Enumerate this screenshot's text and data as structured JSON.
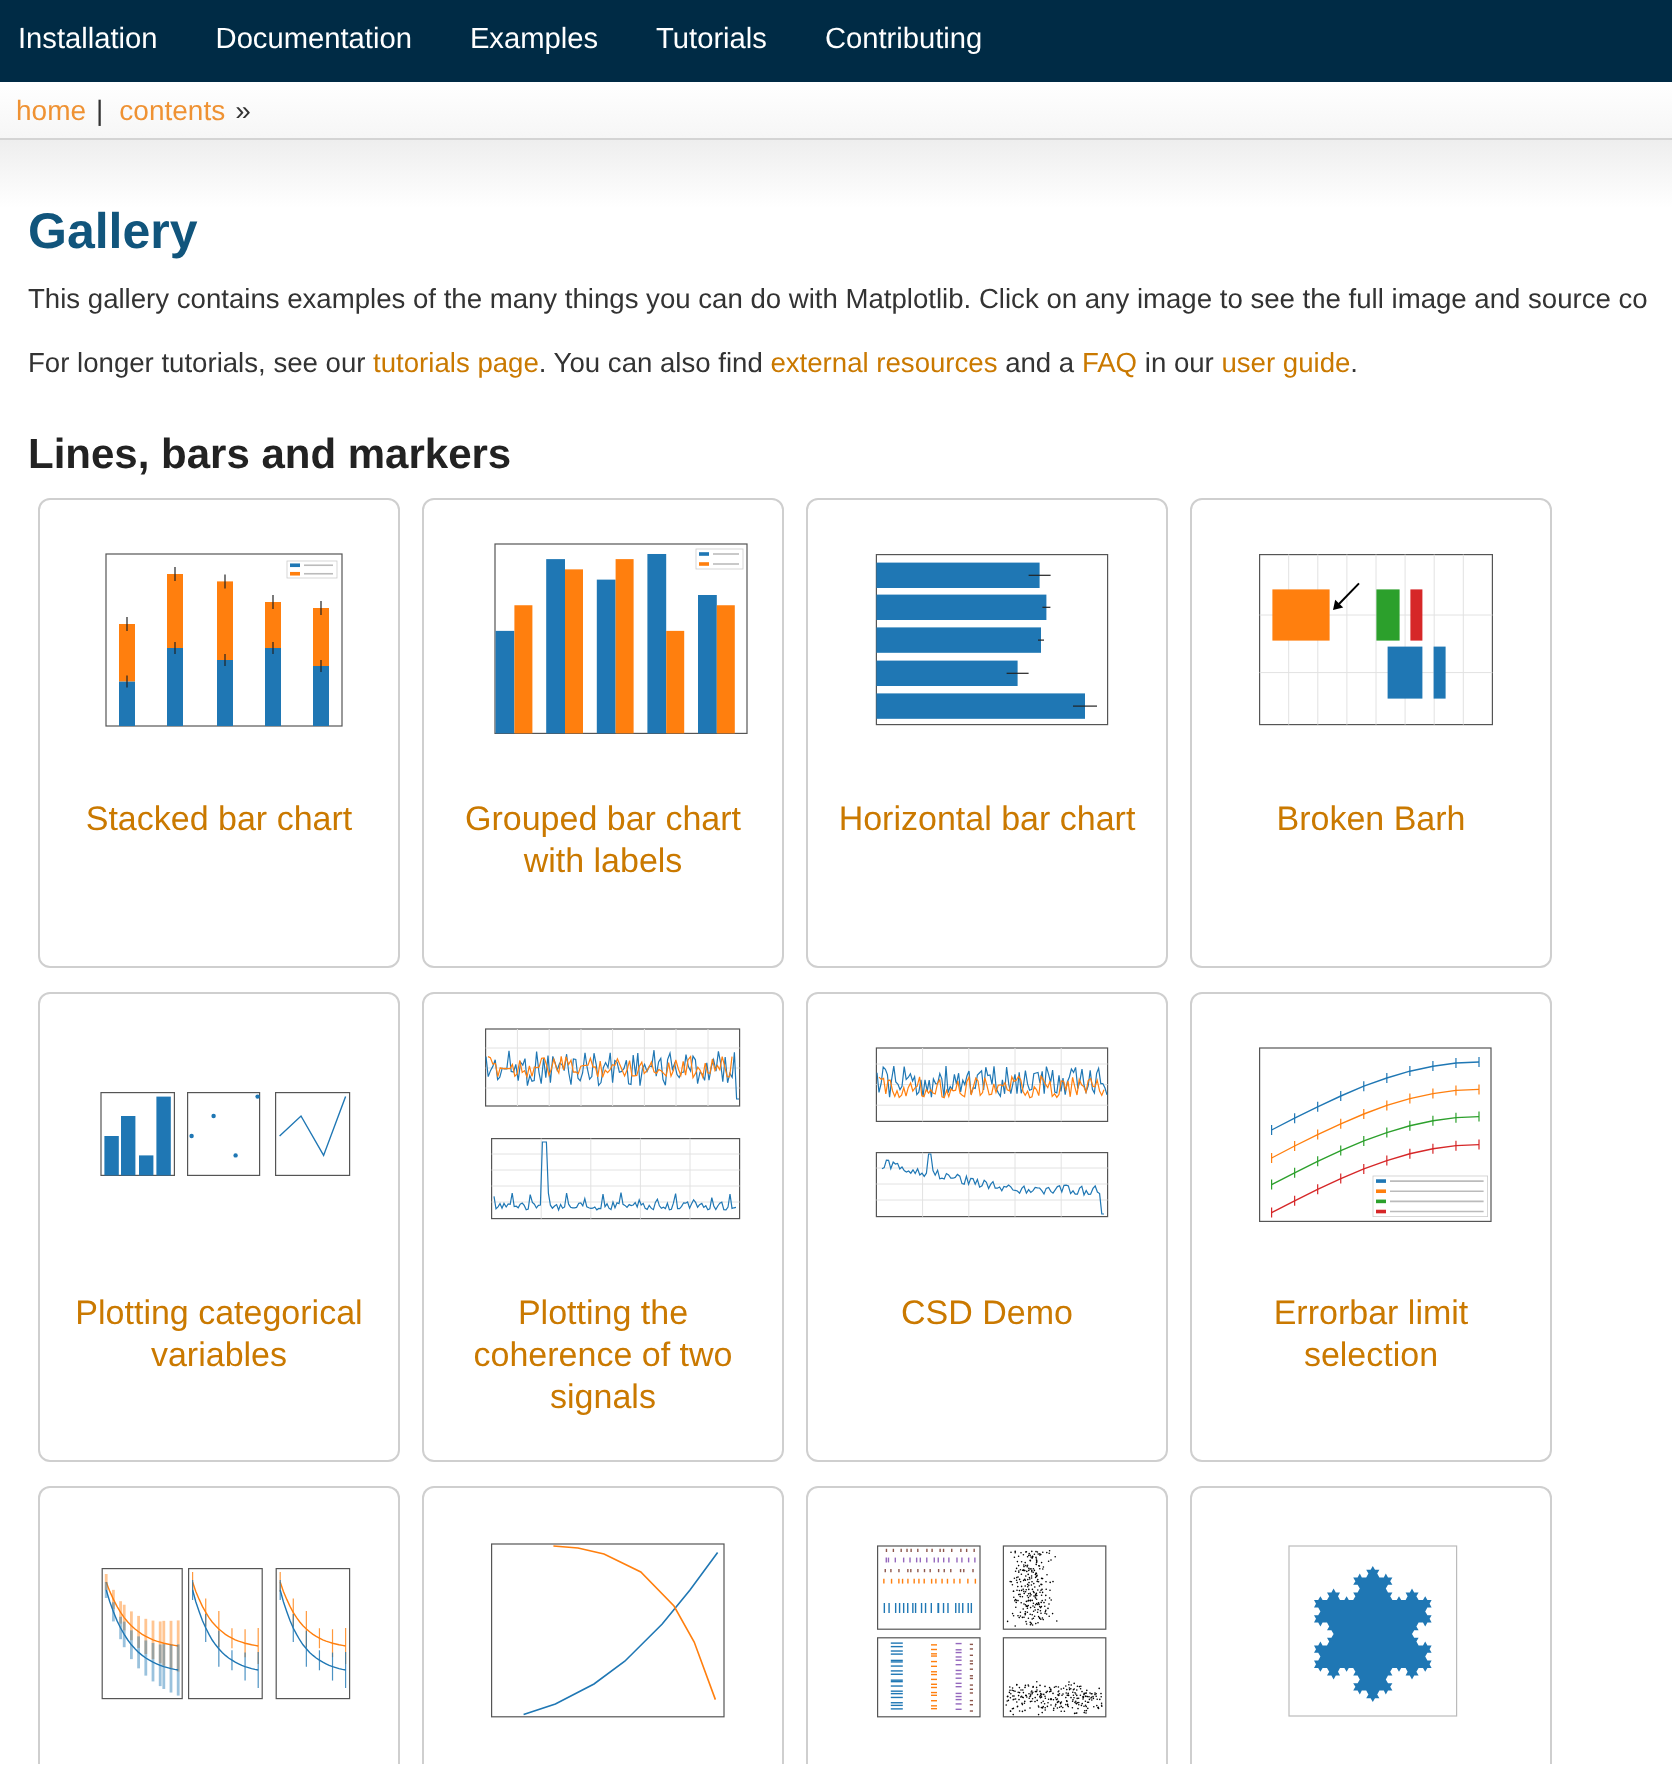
{
  "nav_items": [
    "Installation",
    "Documentation",
    "Examples",
    "Tutorials",
    "Contributing"
  ],
  "breadcrumb": [
    {
      "label": "home",
      "separator": "|"
    },
    {
      "label": "contents",
      "separator": "»"
    }
  ],
  "page": {
    "title": "Gallery",
    "intro": "This gallery contains examples of the many things you can do with Matplotlib. Click on any image to see the full image and source co",
    "more": [
      {
        "kind": "text",
        "text": "For longer tutorials, see our "
      },
      {
        "kind": "link",
        "text": "tutorials page"
      },
      {
        "kind": "text",
        "text": ". You can also find "
      },
      {
        "kind": "link",
        "text": "external resources"
      },
      {
        "kind": "text",
        "text": " and a "
      },
      {
        "kind": "link",
        "text": "FAQ"
      },
      {
        "kind": "text",
        "text": " in our "
      },
      {
        "kind": "link",
        "text": "user guide"
      },
      {
        "kind": "text",
        "text": "."
      }
    ]
  },
  "section": {
    "title": "Lines, bars and markers",
    "examples": [
      {
        "title": "Stacked bar chart",
        "kind": "stacked"
      },
      {
        "title": "Grouped bar chart with labels",
        "kind": "grouped"
      },
      {
        "title": "Horizontal bar chart",
        "kind": "hbar"
      },
      {
        "title": "Broken Barh",
        "kind": "brokenbarh"
      },
      {
        "title": "Plotting categorical variables",
        "kind": "categorical"
      },
      {
        "title": "Plotting the coherence of two signals",
        "kind": "coherence"
      },
      {
        "title": "CSD Demo",
        "kind": "csd"
      },
      {
        "title": "Errorbar limit selection",
        "kind": "errorbar"
      },
      {
        "kind": "subplots"
      },
      {
        "kind": "lineplot"
      },
      {
        "kind": "eventplot"
      },
      {
        "kind": "snowflake"
      }
    ]
  }
}
